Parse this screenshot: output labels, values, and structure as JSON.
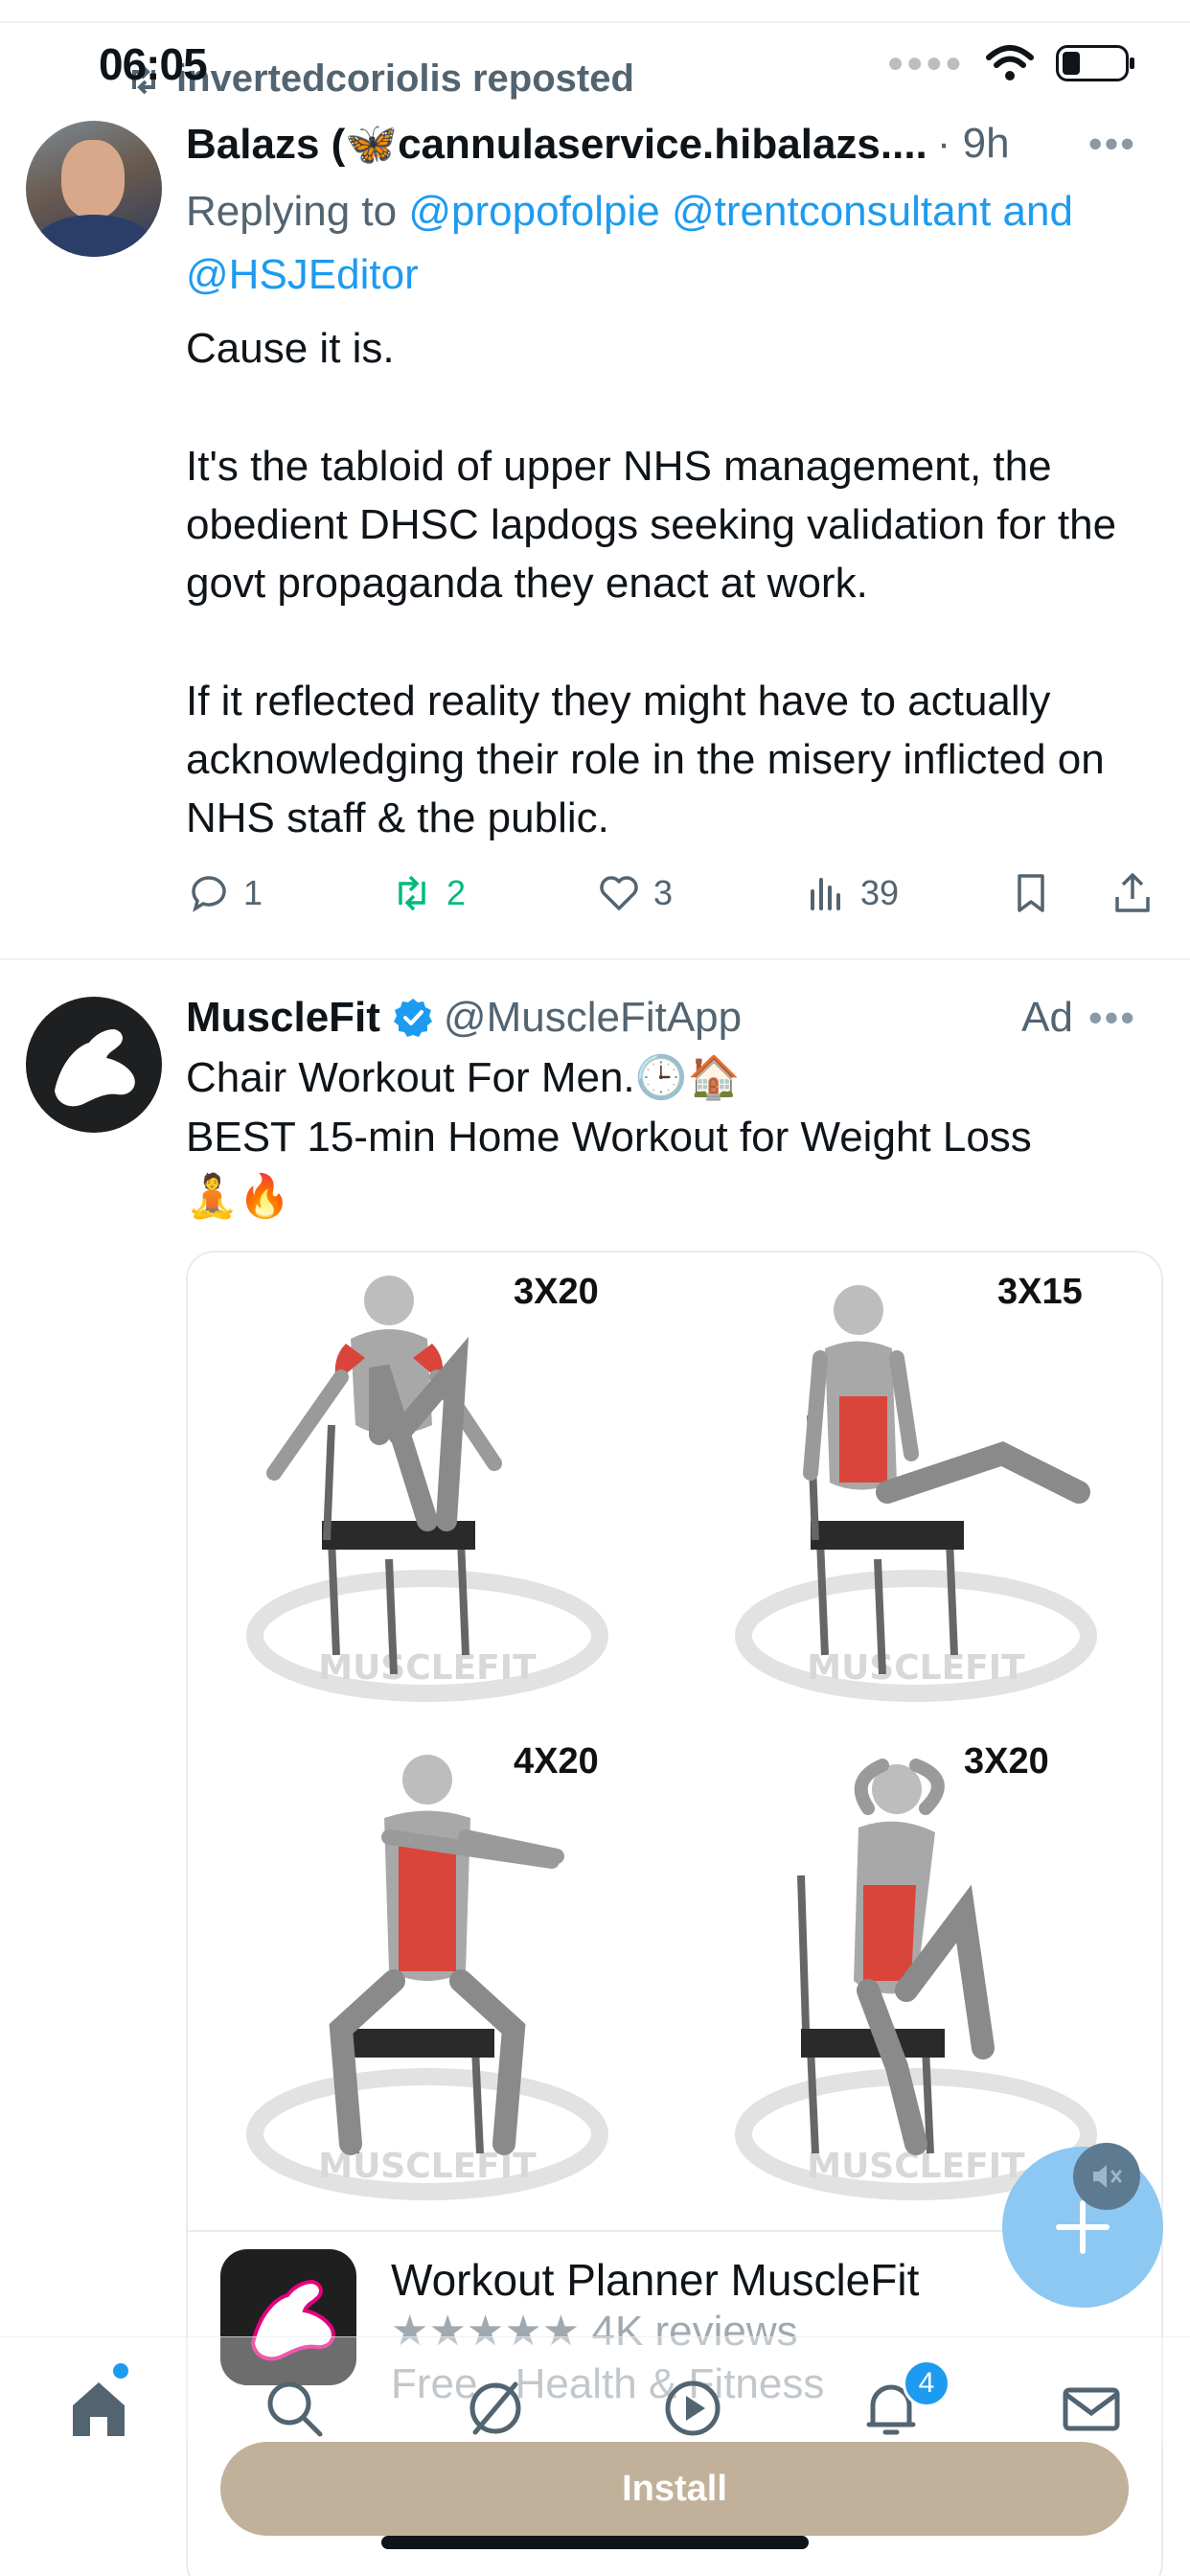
{
  "status_bar": {
    "time": "06:05"
  },
  "repost": {
    "label": "invertedcoriolis reposted"
  },
  "tweet": {
    "author_name": "Balazs (🦋cannulaservice.hibalazs....",
    "time": "· 9h",
    "reply_prefix": "Replying to",
    "reply_handles": [
      "@propofolpie",
      "@trentconsultant",
      "@HSJEditor"
    ],
    "reply_and": "and",
    "paragraphs": [
      "Cause it is.",
      "It's the tabloid of upper NHS management, the obedient DHSC lapdogs seeking validation for the govt propaganda they enact at work.",
      "If it reflected reality they might have to actually acknowledging their role in the misery inflicted on NHS staff & the public."
    ],
    "counts": {
      "replies": "1",
      "reposts": "2",
      "likes": "3",
      "views": "39"
    }
  },
  "ad": {
    "name": "MuscleFit",
    "handle": "@MuscleFitApp",
    "label": "Ad",
    "text_line1": "Chair Workout For Men.🕒🏠",
    "text_line2": "BEST 15-min Home Workout for Weight Loss",
    "text_line3": "🧘🔥",
    "exercises": [
      {
        "reps": "3X20"
      },
      {
        "reps": "3X15"
      },
      {
        "reps": "4X20"
      },
      {
        "reps": "3X20"
      }
    ],
    "watermark": "MUSCLEFIT",
    "app_title": "Workout Planner MuscleFit",
    "app_rating_stars": "★★★★★",
    "app_reviews": "4K reviews",
    "app_category": "Free · Health & Fitness",
    "install_label": "Install"
  },
  "nav": {
    "notifications_badge": "4"
  },
  "colors": {
    "accent": "#1d9bf0",
    "repost_green": "#00ba7c",
    "install_bg": "#c2b19a",
    "muscle_red": "#d9453a"
  }
}
